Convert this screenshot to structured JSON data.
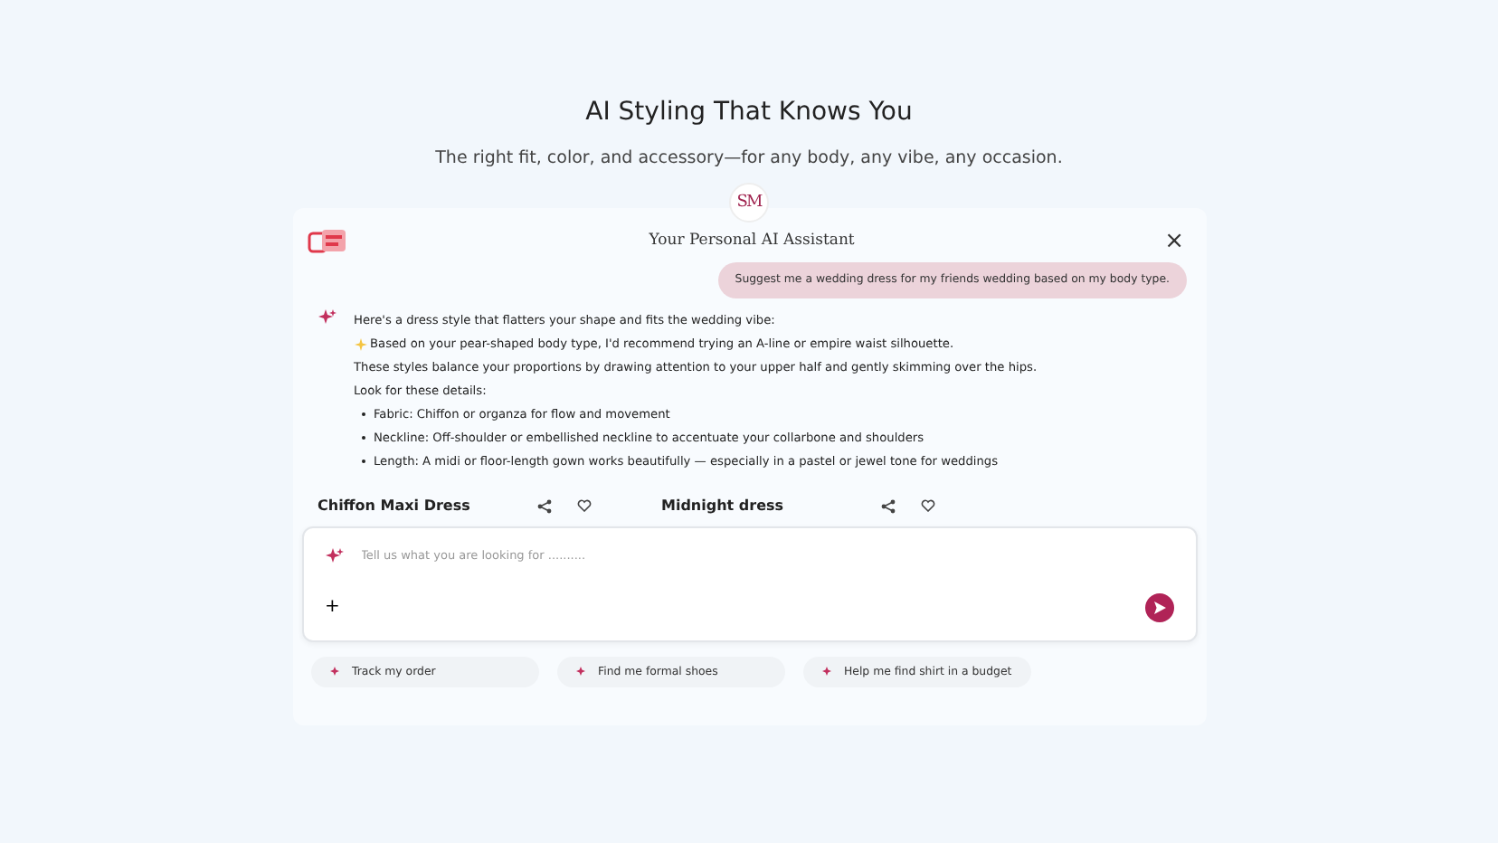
{
  "hero": {
    "title": "AI Styling That Knows You",
    "subtitle": "The right fit, color, and accessory—for any body, any vibe, any occasion."
  },
  "assistant": {
    "monogram": "SM",
    "title": "Your Personal AI Assistant",
    "close": "×"
  },
  "messages": [
    {
      "kind": "user",
      "text": "Suggest me a wedding dress for my friends wedding based on my body type."
    },
    {
      "kind": "bot",
      "lines": [
        {
          "kind": "plain",
          "text": "Here's a dress style that flatters your shape and fits the wedding vibe:"
        },
        {
          "kind": "sparkle",
          "text": "Based on your pear-shaped body type, I'd recommend trying an A-line or empire waist silhouette."
        },
        {
          "kind": "plain",
          "text": " These styles balance your proportions by drawing attention to your upper half and gently skimming over the hips."
        },
        {
          "kind": "plain",
          "text": "Look for these details:"
        },
        {
          "kind": "bullet",
          "text": "Fabric: Chiffon or organza for flow and movement"
        },
        {
          "kind": "bullet",
          "text": "Neckline: Off-shoulder or embellished neckline to accentuate your collarbone and shoulders"
        },
        {
          "kind": "bullet",
          "text": "Length: A midi or floor-length gown works beautifully — especially in a pastel or jewel tone for weddings"
        }
      ]
    }
  ],
  "products": [
    {
      "name": "Chiffon Maxi Dress"
    },
    {
      "name": "Midnight dress"
    }
  ],
  "composer": {
    "placeholder": "Tell us what you are looking for ..........",
    "add": "+"
  },
  "suggestions": [
    "Track my order",
    "Find me formal shoes",
    "Help me find shirt in a budget"
  ]
}
